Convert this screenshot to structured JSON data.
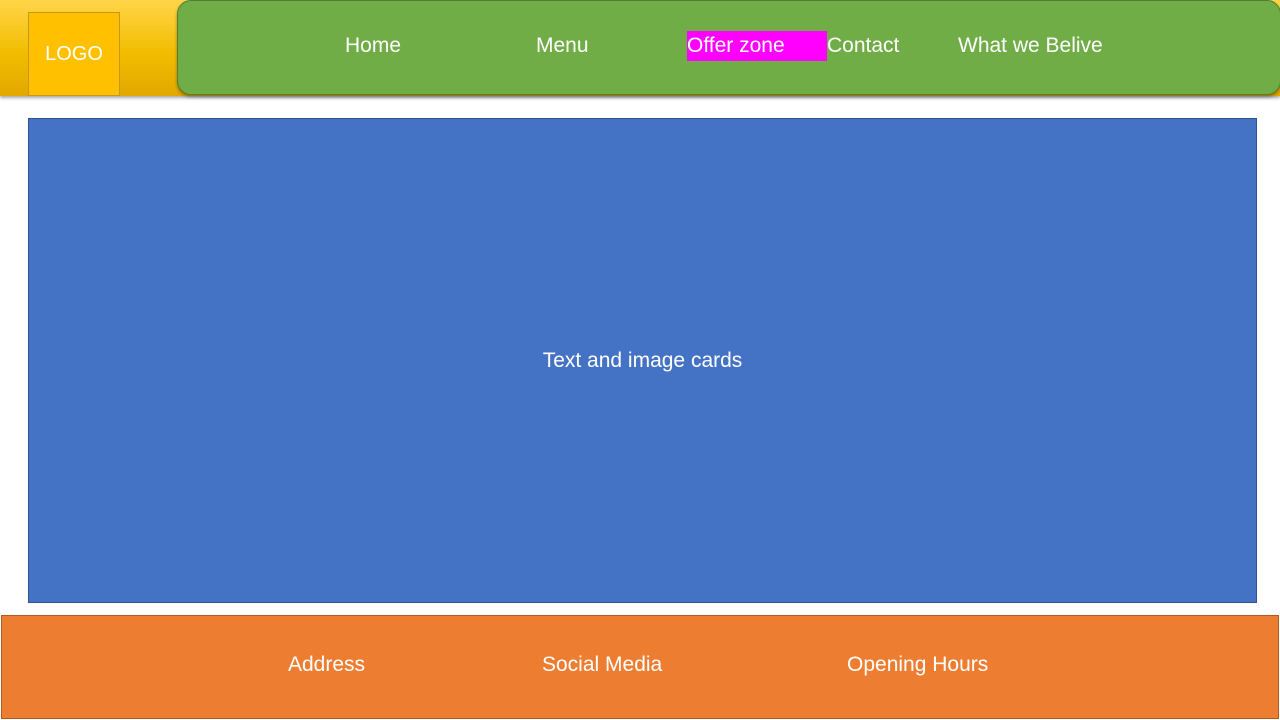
{
  "header": {
    "logo_text": "LOGO",
    "nav": {
      "home": "Home",
      "menu": "Menu",
      "offer_zone": "Offer zone",
      "contact": "Contact",
      "what_we_belive": "What we Belive"
    }
  },
  "main": {
    "label": "Text and image cards"
  },
  "footer": {
    "address": "Address",
    "social_media": "Social Media",
    "opening_hours": "Opening Hours"
  },
  "colors": {
    "header_yellow": "#ffc000",
    "nav_green": "#70ad47",
    "highlight_magenta": "#ff00ff",
    "main_blue": "#4472c4",
    "footer_orange": "#ed7d31"
  }
}
